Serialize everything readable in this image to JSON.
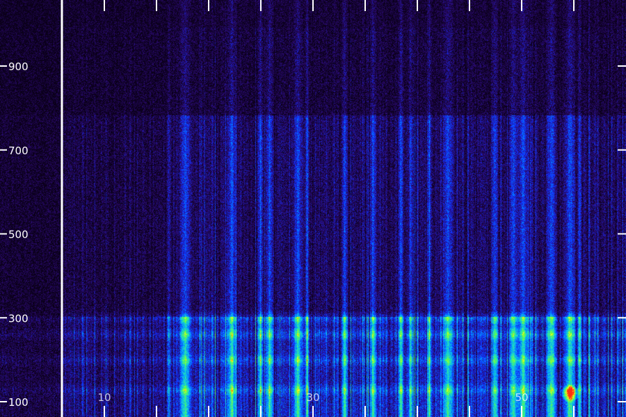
{
  "chart_data": {
    "type": "heatmap",
    "title": "",
    "xlabel": "",
    "ylabel": "",
    "x_ticks": [
      {
        "value": 10,
        "label": "10"
      },
      {
        "value": 30,
        "label": "30"
      },
      {
        "value": 50,
        "label": "50"
      }
    ],
    "y_ticks": [
      {
        "value": 100,
        "label": "100"
      },
      {
        "value": 300,
        "label": "300"
      },
      {
        "value": 500,
        "label": "500"
      },
      {
        "value": 700,
        "label": "700"
      },
      {
        "value": 900,
        "label": "900"
      }
    ],
    "xlim": [
      0,
      60
    ],
    "ylim": [
      80,
      1060
    ],
    "grid": false,
    "colormap": [
      "#0a0018",
      "#2a0a6e",
      "#1030ff",
      "#00a0ff",
      "#20e0c0",
      "#60ff40",
      "#ffff20",
      "#ff3010"
    ],
    "overview": {
      "strong_bands_y": [
        130,
        200,
        260,
        300
      ],
      "strong_columns_x": [
        13,
        18,
        21,
        22,
        25,
        26,
        30,
        33,
        36,
        37,
        39,
        41,
        46,
        48,
        49,
        52,
        54,
        55
      ],
      "peak_point": {
        "x": 54,
        "y": 120
      }
    },
    "vertical_line_x": [
      0
    ]
  }
}
